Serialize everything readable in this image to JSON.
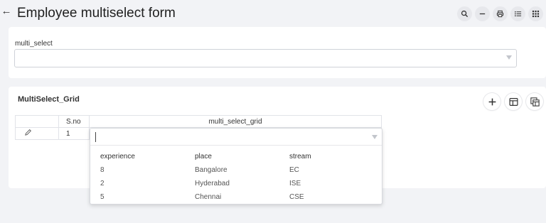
{
  "header": {
    "title": "Employee multiselect form"
  },
  "toolbar": {
    "icons": [
      "search-icon",
      "minus-icon",
      "print-icon",
      "list-icon",
      "grid-icon"
    ]
  },
  "form": {
    "multi_select_label": "multi_select",
    "multi_select_value": ""
  },
  "grid_section": {
    "title": "MultiSelect_Grid",
    "columns": {
      "sno": "S.no",
      "multi_select_grid": "multi_select_grid"
    },
    "rows": [
      {
        "sno": "1",
        "multi_select_grid": ""
      }
    ]
  },
  "dropdown": {
    "headers": {
      "experience": "experience",
      "place": "place",
      "stream": "stream"
    },
    "options": [
      {
        "experience": "8",
        "place": "Bangalore",
        "stream": "EC"
      },
      {
        "experience": "2",
        "place": "Hyderabad",
        "stream": "ISE"
      },
      {
        "experience": "5",
        "place": "Chennai",
        "stream": "CSE"
      }
    ]
  }
}
